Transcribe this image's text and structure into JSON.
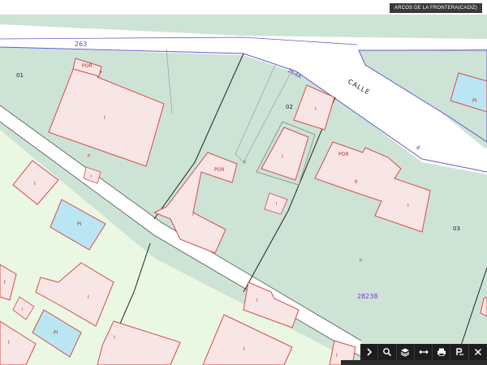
{
  "header": {
    "location": "ARCOS DE LA FRONTERA(CADIZ)"
  },
  "colors": {
    "parcel_fill": "#cde3d6",
    "parcel_fill_light": "#e9f7e3",
    "road_fill": "#ffffff",
    "building_fill": "#f8e5e5",
    "building_stroke": "#d94a4a",
    "pool_fill": "#b9e6f2",
    "line_dark": "#222222",
    "road_edge": "#6a5acd",
    "label_red": "#c0262b",
    "label_purple": "#6a3fbf"
  },
  "street": {
    "name": "CALLE"
  },
  "road_numbers": {
    "a": "263",
    "b": "264A",
    "c": "4"
  },
  "parcels": {
    "p01": "01",
    "p02": "02",
    "p03": "03",
    "cadastral_ref": "28238"
  },
  "labels": {
    "por": "POR",
    "one": "I",
    "two": "II",
    "pi": "PI",
    "patio": "P"
  },
  "toolbar": {
    "items": [
      {
        "icon": "chevron-right-icon"
      },
      {
        "icon": "zoom-icon"
      },
      {
        "icon": "layers-icon"
      },
      {
        "icon": "measure-icon"
      },
      {
        "icon": "print-icon"
      },
      {
        "icon": "parcel-info-icon"
      },
      {
        "icon": "close-icon"
      }
    ]
  }
}
